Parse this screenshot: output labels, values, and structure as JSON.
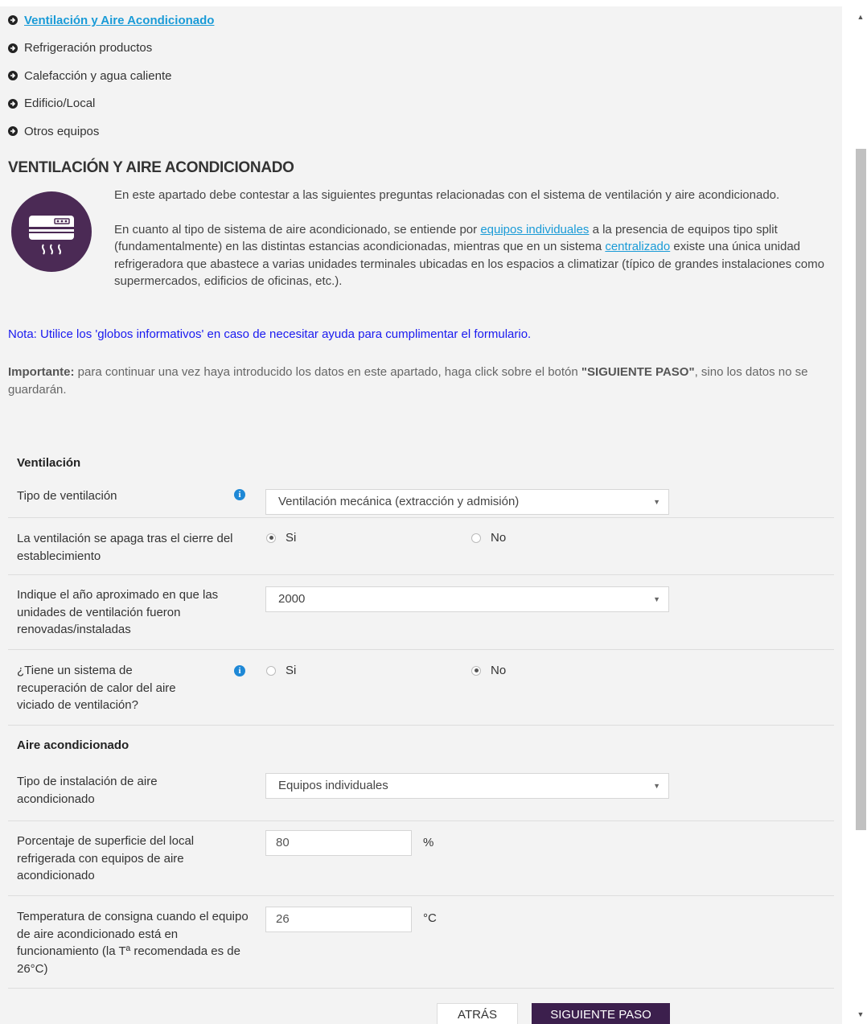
{
  "nav": {
    "items": [
      {
        "label": "Ventilación y Aire Acondicionado",
        "active": true
      },
      {
        "label": "Refrigeración productos"
      },
      {
        "label": "Calefacción y agua caliente"
      },
      {
        "label": "Edificio/Local"
      },
      {
        "label": "Otros equipos"
      }
    ]
  },
  "section": {
    "title": "VENTILACIÓN Y AIRE ACONDICIONADO",
    "intro_1": "En este apartado debe contestar a las siguientes preguntas relacionadas con el sistema de ventilación y aire acondicionado.",
    "intro_2_a": "En cuanto al tipo de sistema de aire acondicionado, se entiende por ",
    "intro_2_link1": "equipos individuales",
    "intro_2_b": " a la presencia de equipos tipo split (fundamentalmente) en las distintas estancias acondicionadas, mientras que en un sistema ",
    "intro_2_link2": "centralizado",
    "intro_2_c": " existe una única unidad refrigeradora que abastece a varias unidades terminales ubicadas en los espacios a climatizar (típico de grandes instalaciones como supermercados, edificios de oficinas, etc.).",
    "note": "Nota: Utilice los 'globos informativos' en caso de necesitar ayuda para cumplimentar el formulario.",
    "important_label": "Importante:",
    "important_a": " para continuar una vez haya introducido los datos en este apartado, haga click sobre el botón ",
    "important_btn": "\"SIGUIENTE PASO\"",
    "important_b": ", sino los datos no se guardarán."
  },
  "form": {
    "ventilation_title": "Ventilación",
    "tipo_ventilacion_label": "Tipo de ventilación",
    "tipo_ventilacion_value": "Ventilación mecánica (extracción y admisión)",
    "apaga_label": "La ventilación se apaga tras el cierre del establecimiento",
    "apaga_si": "Si",
    "apaga_no": "No",
    "anio_label": "Indique el año aproximado en que las unidades de ventilación fueron renovadas/instaladas",
    "anio_value": "2000",
    "recuperacion_label": "¿Tiene un sistema de recuperación de calor del aire viciado de ventilación?",
    "recuperacion_si": "Si",
    "recuperacion_no": "No",
    "ac_title": "Aire acondicionado",
    "tipo_instalacion_label": "Tipo de instalación de aire acondicionado",
    "tipo_instalacion_value": "Equipos individuales",
    "porcentaje_label": "Porcentaje de superficie del local refrigerada con equipos de aire acondicionado",
    "porcentaje_value": "80",
    "porcentaje_unit": "%",
    "temperatura_label": "Temperatura de consigna cuando el equipo de aire acondicionado está en funcionamiento (la Tª recomendada es de 26°C)",
    "temperatura_value": "26",
    "temperatura_unit": "°C"
  },
  "buttons": {
    "back": "ATRÁS",
    "next": "SIGUIENTE PASO"
  },
  "colors": {
    "accent_purple": "#3c1f4d",
    "link_blue": "#1a9bd7",
    "note_blue": "#1a1af0"
  }
}
